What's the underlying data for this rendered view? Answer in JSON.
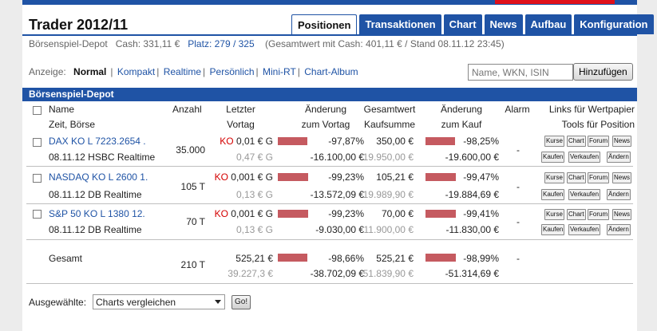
{
  "header": {
    "title": "Trader 2012/11"
  },
  "tabs": [
    "Positionen",
    "Transaktionen",
    "Chart",
    "News",
    "Aufbau",
    "Konfiguration"
  ],
  "info": {
    "depot": "Börsenspiel-Depot",
    "cash": "Cash: 331,11 €",
    "platz": "Platz: 279 / 325",
    "gesamt": "(Gesamtwert mit Cash: 401,11 € / Stand 08.11.12 23:45)"
  },
  "anzeige": {
    "label": "Anzeige:",
    "current": "Normal",
    "options": [
      "Kompakt",
      "Realtime",
      "Persönlich",
      "Mini-RT",
      "Chart-Album"
    ]
  },
  "search": {
    "placeholder": "Name, WKN, ISIN",
    "button": "Hinzufügen"
  },
  "section_title": "Börsenspiel-Depot",
  "columns": {
    "name": "Name",
    "zeit": "Zeit, Börse",
    "anzahl": "Anzahl",
    "letzter1": "Letzter",
    "letzter2": "Vortag",
    "aend1": "Änderung",
    "aend2": "zum Vortag",
    "gw1": "Gesamtwert",
    "gw2": "Kaufsumme",
    "ak1": "Änderung",
    "ak2": "zum Kauf",
    "alarm": "Alarm",
    "links1": "Links für Wertpapier",
    "links2": "Tools für Position"
  },
  "rows": [
    {
      "name": "DAX KO L 7223.2654 .",
      "zeit": "08.11.12 HSBC Realtime",
      "anzahl": "35.000",
      "ko": "KO",
      "letzter": "0,01 € G",
      "vortag": "0,47 € G",
      "aend_pct": "-97,87%",
      "aend_abs": "-16.100,00 €",
      "gesamtwert": "350,00 €",
      "kaufsumme": "19.950,00 €",
      "kauf_pct": "-98,25%",
      "kauf_abs": "-19.600,00 €",
      "alarm": "-",
      "aend_frac": 0.9787,
      "kauf_frac": 0.9825
    },
    {
      "name": "NASDAQ KO L 2600 1.",
      "zeit": "08.11.12 DB Realtime",
      "anzahl": "105 T",
      "ko": "KO",
      "letzter": "0,001 € G",
      "vortag": "0,13 € G",
      "aend_pct": "-99,23%",
      "aend_abs": "-13.572,09 €",
      "gesamtwert": "105,21 €",
      "kaufsumme": "19.989,90 €",
      "kauf_pct": "-99,47%",
      "kauf_abs": "-19.884,69 €",
      "alarm": "-",
      "aend_frac": 0.9923,
      "kauf_frac": 0.9947
    },
    {
      "name": "S&P 50 KO L 1380 12.",
      "zeit": "08.11.12 DB Realtime",
      "anzahl": "70 T",
      "ko": "KO",
      "letzter": "0,001 € G",
      "vortag": "0,13 € G",
      "aend_pct": "-99,23%",
      "aend_abs": "-9.030,00 €",
      "gesamtwert": "70,00 €",
      "kaufsumme": "11.900,00 €",
      "kauf_pct": "-99,41%",
      "kauf_abs": "-11.830,00 €",
      "alarm": "-",
      "aend_frac": 0.9923,
      "kauf_frac": 0.9941
    }
  ],
  "total": {
    "label": "Gesamt",
    "anzahl": "210 T",
    "letzter": "525,21 €",
    "vortag": "39.227,3 €",
    "aend_pct": "-98,66%",
    "aend_abs": "-38.702,09 €",
    "gesamtwert": "525,21 €",
    "kaufsumme": "51.839,90 €",
    "kauf_pct": "-98,99%",
    "kauf_abs": "-51.314,69 €",
    "alarm": "-",
    "aend_frac": 0.9866,
    "kauf_frac": 0.9899
  },
  "row_buttons": {
    "top": [
      "Kurse",
      "Chart",
      "Forum",
      "News"
    ],
    "bottom": [
      "Kaufen",
      "Verkaufen",
      "Ändern"
    ]
  },
  "footer": {
    "label": "Ausgewählte:",
    "select_value": "Charts vergleichen",
    "go": "Go!"
  },
  "colors": {
    "accent": "#1f53a5",
    "bar": "#c55a60",
    "ko": "#d40000"
  }
}
